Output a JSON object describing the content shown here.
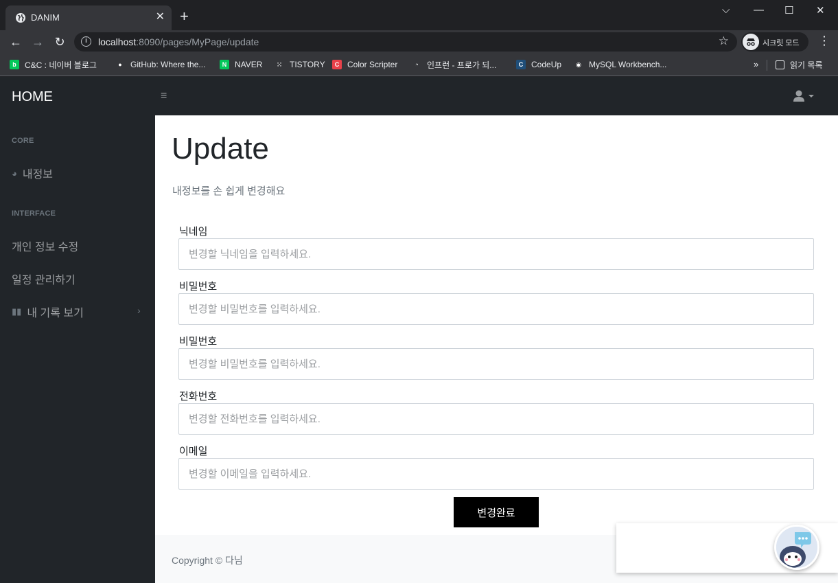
{
  "browser": {
    "tab_title": "DANIM",
    "tab_close": "✕",
    "new_tab": "+",
    "url_host": "localhost",
    "url_path": ":8090/pages/MyPage/update",
    "incognito_label": "시크릿 모드",
    "window_controls": {
      "dropdown": "⌵",
      "minimize": "—",
      "maximize": "☐",
      "close": "✕"
    },
    "bookmarks": [
      {
        "label": "C&C : 네이버 블로그",
        "icon": "blog-icon",
        "color": "#03c75a",
        "glyph": "b"
      },
      {
        "label": "GitHub: Where the...",
        "icon": "github-icon",
        "color": "#35363a",
        "glyph": "●"
      },
      {
        "label": "NAVER",
        "icon": "naver-icon",
        "color": "#03c75a",
        "glyph": "N"
      },
      {
        "label": "TISTORY",
        "icon": "tistory-icon",
        "color": "#35363a",
        "glyph": "⁙"
      },
      {
        "label": "Color Scripter",
        "icon": "colorscripter-icon",
        "color": "#e8414a",
        "glyph": "C"
      },
      {
        "label": "인프런 - 프로가 되...",
        "icon": "inflearn-icon",
        "color": "#35363a",
        "glyph": "◔"
      },
      {
        "label": "CodeUp",
        "icon": "codeup-icon",
        "color": "#1f4e79",
        "glyph": "C"
      },
      {
        "label": "MySQL Workbench...",
        "icon": "globe-icon",
        "color": "#35363a",
        "glyph": "◉"
      }
    ],
    "bookmarks_more": "»",
    "reading_list": "읽기 목록"
  },
  "app": {
    "brand": "HOME",
    "sidebar": {
      "headings": {
        "core": "CORE",
        "interface": "INTERFACE"
      },
      "items": {
        "my_info": "내정보",
        "edit_profile": "개인 정보 수정",
        "schedule": "일정 관리하기",
        "records": "내 기록 보기"
      }
    },
    "page": {
      "title": "Update",
      "subtitle": "내정보를 손 쉽게 변경해요"
    },
    "form": {
      "fields": [
        {
          "label": "닉네임",
          "placeholder": "변경할 닉네임을 입력하세요."
        },
        {
          "label": "비밀번호",
          "placeholder": "변경할 비밀번호를 입력하세요."
        },
        {
          "label": "비밀번호",
          "placeholder": "변경할 비밀번호를 입력하세요."
        },
        {
          "label": "전화번호",
          "placeholder": "변경할 전화번호를 입력하세요."
        },
        {
          "label": "이메일",
          "placeholder": "변경할 이메일을 입력하세요."
        }
      ],
      "submit_label": "변경완료"
    },
    "footer": {
      "copyright": "Copyright © 다님"
    }
  }
}
